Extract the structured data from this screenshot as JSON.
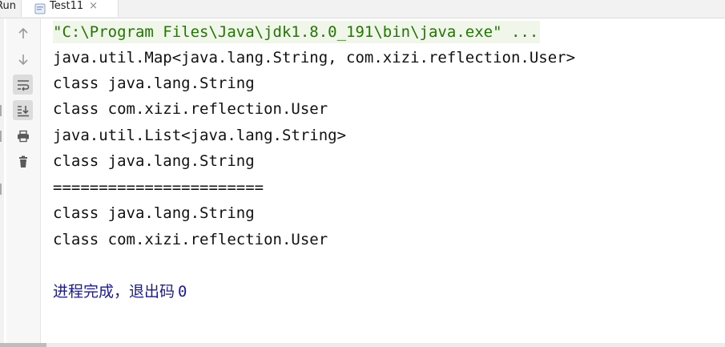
{
  "run_panel": {
    "label": "Run:",
    "tab": {
      "title": "Test11",
      "close_glyph": "×",
      "icon": "java-class-icon"
    }
  },
  "toolbar": {
    "buttons": [
      {
        "name": "up-arrow-icon",
        "tooltip": "Up"
      },
      {
        "name": "down-arrow-icon",
        "tooltip": "Down"
      },
      {
        "name": "soft-wrap-icon",
        "active": true
      },
      {
        "name": "scroll-to-end-icon",
        "active": true
      },
      {
        "name": "print-icon"
      },
      {
        "name": "trash-icon"
      }
    ]
  },
  "console": {
    "command": "\"C:\\Program Files\\Java\\jdk1.8.0_191\\bin\\java.exe\" ...",
    "lines": [
      "java.util.Map<java.lang.String, com.xizi.reflection.User>",
      "class java.lang.String",
      "class com.xizi.reflection.User",
      "java.util.List<java.lang.String>",
      "class java.lang.String",
      "=======================",
      "class java.lang.String",
      "class com.xizi.reflection.User"
    ],
    "exit_message": "进程完成，退出码",
    "exit_code": "0"
  },
  "colors": {
    "command_text": "#227700",
    "command_bg": "#f0f6ea",
    "exit_text": "#1a1a9a",
    "output_text": "#111111"
  }
}
